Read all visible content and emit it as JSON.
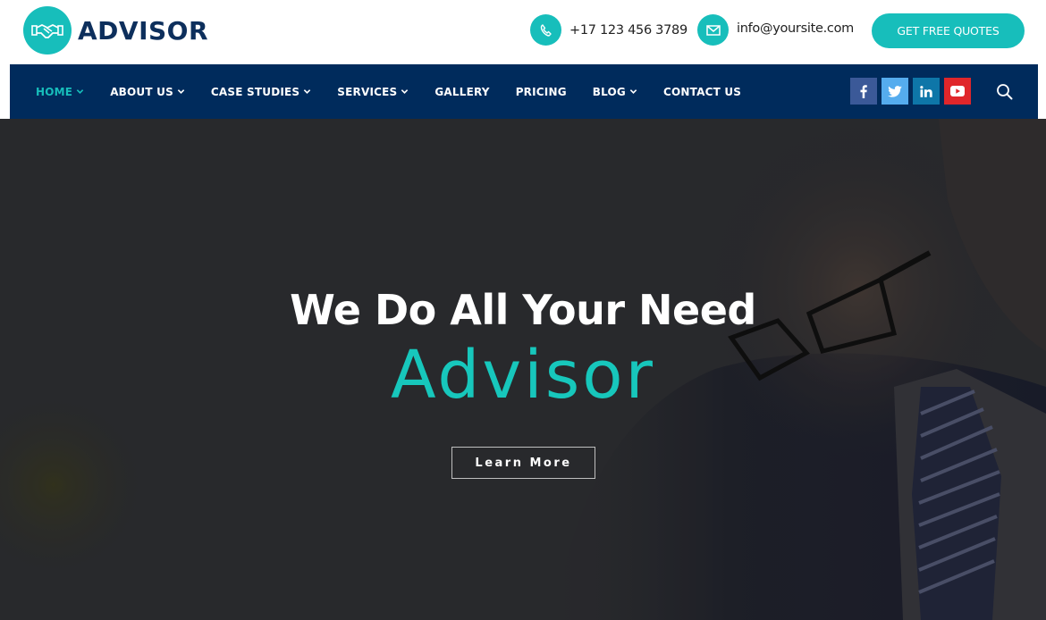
{
  "brand": {
    "name": "ADVISOR",
    "logo_icon": "handshake-icon",
    "accent_color": "#17bebb",
    "navy_color": "#002b5c"
  },
  "header": {
    "phone": {
      "icon": "phone-icon",
      "text": "+17 123 456 3789"
    },
    "email": {
      "icon": "envelope-icon",
      "text": "info@yoursite.com"
    },
    "cta_label": "GET FREE QUOTES"
  },
  "nav": {
    "items": [
      {
        "label": "HOME",
        "has_dropdown": true,
        "active": true
      },
      {
        "label": "ABOUT US",
        "has_dropdown": true,
        "active": false
      },
      {
        "label": "CASE STUDIES",
        "has_dropdown": true,
        "active": false
      },
      {
        "label": "SERVICES",
        "has_dropdown": true,
        "active": false
      },
      {
        "label": "GALLERY",
        "has_dropdown": false,
        "active": false
      },
      {
        "label": "PRICING",
        "has_dropdown": false,
        "active": false
      },
      {
        "label": "BLOG",
        "has_dropdown": true,
        "active": false
      },
      {
        "label": "CONTACT US",
        "has_dropdown": false,
        "active": false
      }
    ],
    "social": [
      {
        "name": "facebook",
        "icon": "facebook-icon",
        "glyph": "f",
        "color": "#3b5998"
      },
      {
        "name": "twitter",
        "icon": "twitter-icon",
        "glyph": "t",
        "color": "#55acee"
      },
      {
        "name": "linkedin",
        "icon": "linkedin-icon",
        "glyph": "in",
        "color": "#0e76a8"
      },
      {
        "name": "youtube",
        "icon": "youtube-icon",
        "glyph": "▶",
        "color": "#e0262a"
      }
    ],
    "search_icon": "search-icon"
  },
  "hero": {
    "title": "We Do All Your Need",
    "subtitle": "Advisor",
    "button_label": "Learn More",
    "subtitle_color": "#17d0c4"
  }
}
